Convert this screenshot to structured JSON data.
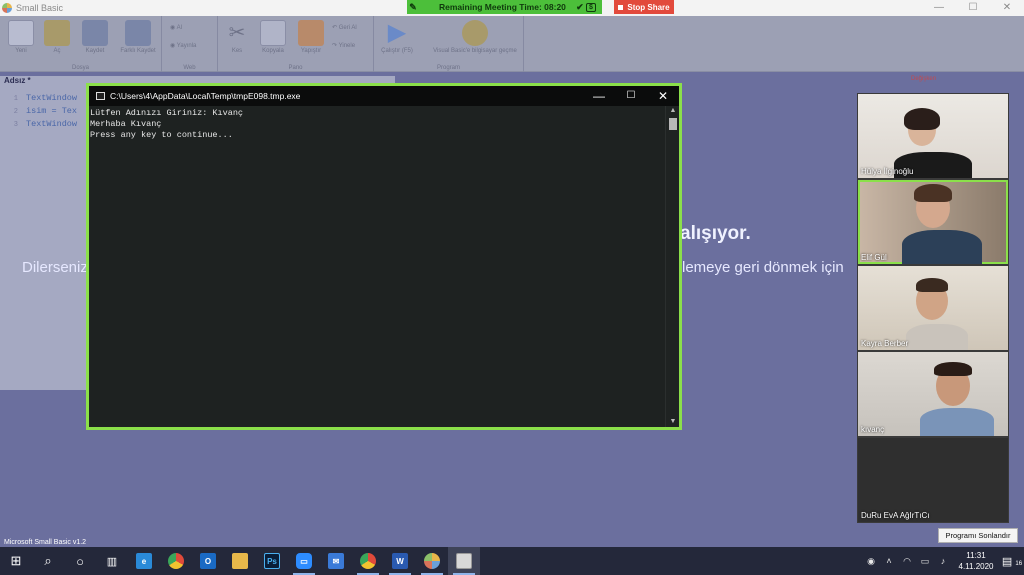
{
  "app": {
    "title": "Small Basic",
    "status_text": "Microsoft Small Basic v1.2"
  },
  "meeting": {
    "remaining_label": "Remaining Meeting Time: 08:20",
    "stop_share_label": "Stop Share"
  },
  "ribbon": {
    "groups": {
      "file": "Dosya",
      "web": "Web",
      "edit": "Pano",
      "program": "Program"
    },
    "buttons": {
      "new": "Yeni",
      "open": "Aç",
      "save": "Kaydet",
      "save_as": "Farklı Kaydet",
      "import": "Al",
      "publish": "Yayınla",
      "cut": "Kes",
      "copy": "Kopyala",
      "paste": "Yapıştır",
      "undo": "Geri Al",
      "redo": "Yinele",
      "run": "Çalıştır (F5)",
      "graduate": "Visual Basic'e bilgisayar geçme"
    }
  },
  "editor": {
    "tab_label": "Adsız *",
    "lines": [
      {
        "num": "1",
        "code": "TextWindow"
      },
      {
        "num": "2",
        "code": "isim = Tex"
      },
      {
        "num": "3",
        "code": "TextWindow"
      }
    ]
  },
  "side_panel": {
    "label": "Değişken"
  },
  "background_message": {
    "title_fragment": "alışıyor.",
    "left_fragment": "Dilerseniz",
    "right_fragment": "lemeye geri dönmek için"
  },
  "console": {
    "title": "C:\\Users\\4\\AppData\\Local\\Temp\\tmpE098.tmp.exe",
    "lines": [
      "Lütfen Adınızı Giriniz: Kıvanç",
      "Merhaba Kıvanç",
      "Press any key to continue..."
    ]
  },
  "participants": [
    {
      "name": "Hülya İlginoğlu",
      "active": false
    },
    {
      "name": "Elif Gül",
      "active": true
    },
    {
      "name": "Kayra Berber",
      "active": false
    },
    {
      "name": "kıvanç",
      "active": false
    },
    {
      "name": "DuRu EvA  AğIrTıCı",
      "active": false
    }
  ],
  "end_program_label": "Programı Sonlandır",
  "taskbar": {
    "time": "11:31",
    "date": "4.11.2020",
    "notification_count": "16"
  },
  "colors": {
    "console_border": "#8be04a",
    "meeting_banner": "#4cbf3a",
    "stop_share": "#e24a3c",
    "taskbar": "#24283a"
  }
}
